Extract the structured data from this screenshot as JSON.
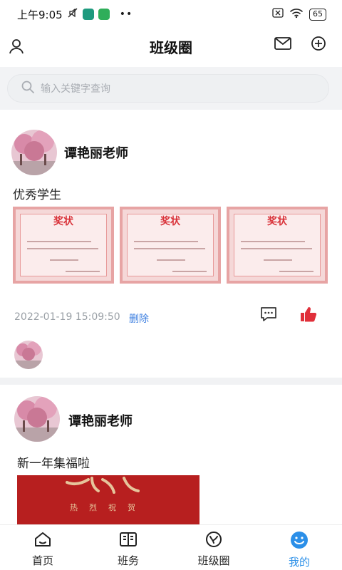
{
  "status_bar": {
    "time": "上午9:05",
    "battery": "65"
  },
  "header": {
    "title": "班级圈"
  },
  "search": {
    "placeholder": "输入关键字查询"
  },
  "posts": [
    {
      "author": "谭艳丽老师",
      "text": "优秀学生",
      "cert_title": "奖状",
      "timestamp": "2022-01-19 15:09:50",
      "delete_label": "删除"
    },
    {
      "author": "谭艳丽老师",
      "text": "新一年集福啦",
      "banner_text": "热烈祝贺"
    }
  ],
  "bottom_nav": [
    {
      "label": "首页",
      "icon": "home-icon"
    },
    {
      "label": "班务",
      "icon": "book-icon"
    },
    {
      "label": "班级圈",
      "icon": "circle-icon"
    },
    {
      "label": "我的",
      "icon": "profile-icon",
      "active": true
    }
  ],
  "colors": {
    "accent": "#2b8fe8",
    "like": "#e02f3a",
    "delete_link": "#3d7fe0",
    "cert_title": "#d9333a",
    "banner": "#b71f1f"
  }
}
